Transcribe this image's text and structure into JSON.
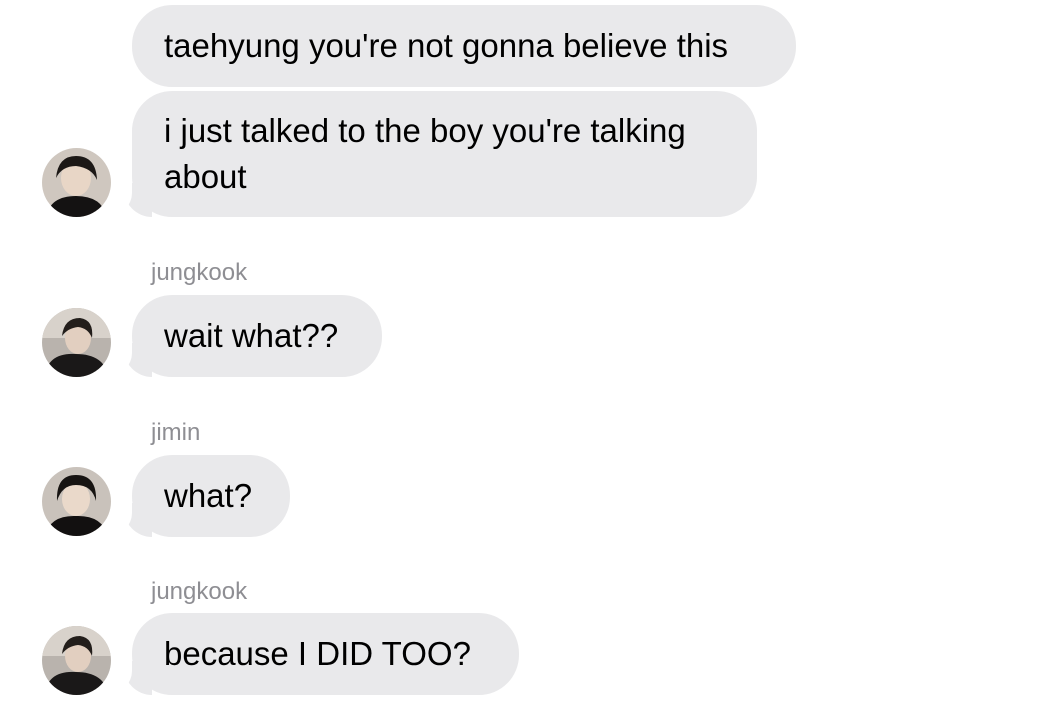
{
  "messages": [
    {
      "text": "taehyung you're not gonna believe this"
    },
    {
      "text": "i just talked to the boy you're talking about"
    },
    {
      "sender": "jungkook",
      "text": "wait what??"
    },
    {
      "sender": "jimin",
      "text": "what?"
    },
    {
      "sender": "jungkook",
      "text": "because I DID TOO?"
    }
  ],
  "colors": {
    "bubble": "#e9e9eb",
    "sender_label": "#8e8e93",
    "background": "#ffffff"
  },
  "icons": {
    "avatar": "profile-photo-avatar-icon"
  }
}
